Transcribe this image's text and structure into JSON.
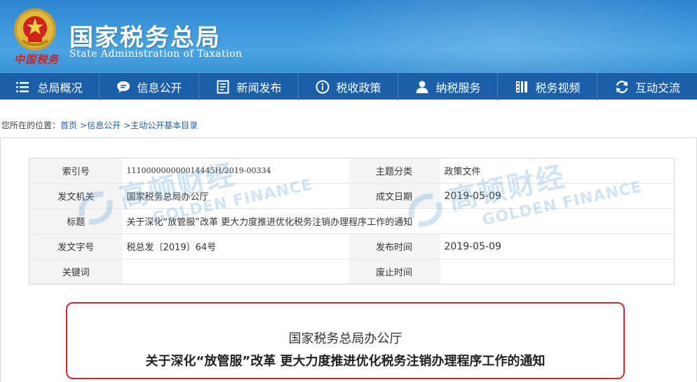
{
  "header": {
    "title": "国家税务总局",
    "subtitle": "State Administration of Taxation",
    "emblem_text": "中国税务"
  },
  "nav": {
    "items": [
      {
        "label": "总局概况",
        "icon": "menu-icon"
      },
      {
        "label": "信息公开",
        "icon": "chat-bubble-icon"
      },
      {
        "label": "新闻发布",
        "icon": "document-icon"
      },
      {
        "label": "税收政策",
        "icon": "info-icon"
      },
      {
        "label": "纳税服务",
        "icon": "person-icon"
      },
      {
        "label": "税务视频",
        "icon": "film-icon"
      },
      {
        "label": "互动交流",
        "icon": "refresh-icon"
      }
    ]
  },
  "breadcrumb": {
    "prefix": "您所在的位置：",
    "items": [
      "首页",
      ">信息公开",
      ">主动公开基本目录"
    ]
  },
  "meta": {
    "index_label": "索引号",
    "index_value": "111000000000014445H/2019-00334",
    "topic_label": "主题分类",
    "topic_value": "政策文件",
    "issuer_label": "发文机关",
    "issuer_value": "国家税务总局办公厅",
    "created_label": "成文日期",
    "created_value": "2019-05-09",
    "title_label": "标题",
    "title_value": "关于深化“放管服”改革 更大力度推进优化税务注销办理程序工作的通知",
    "docno_label": "发文字号",
    "docno_value": "税总发〔2019〕64号",
    "published_label": "发布时间",
    "published_value": "2019-05-09",
    "keywords_label": "关键词",
    "keywords_value": "",
    "expiry_label": "废止时间",
    "expiry_value": ""
  },
  "watermark": {
    "cn": "高顿财经",
    "en": "GOLDEN FINANCE"
  },
  "document": {
    "issuer": "国家税务总局办公厅",
    "title": "关于深化“放管服”改革 更大力度推进优化税务注销办理程序工作的通知"
  },
  "colors": {
    "header_blue": "#3d97dc",
    "nav_blue": "#1b5fa8",
    "link_blue": "#1f5fa6",
    "frame_red": "#d9262a"
  }
}
